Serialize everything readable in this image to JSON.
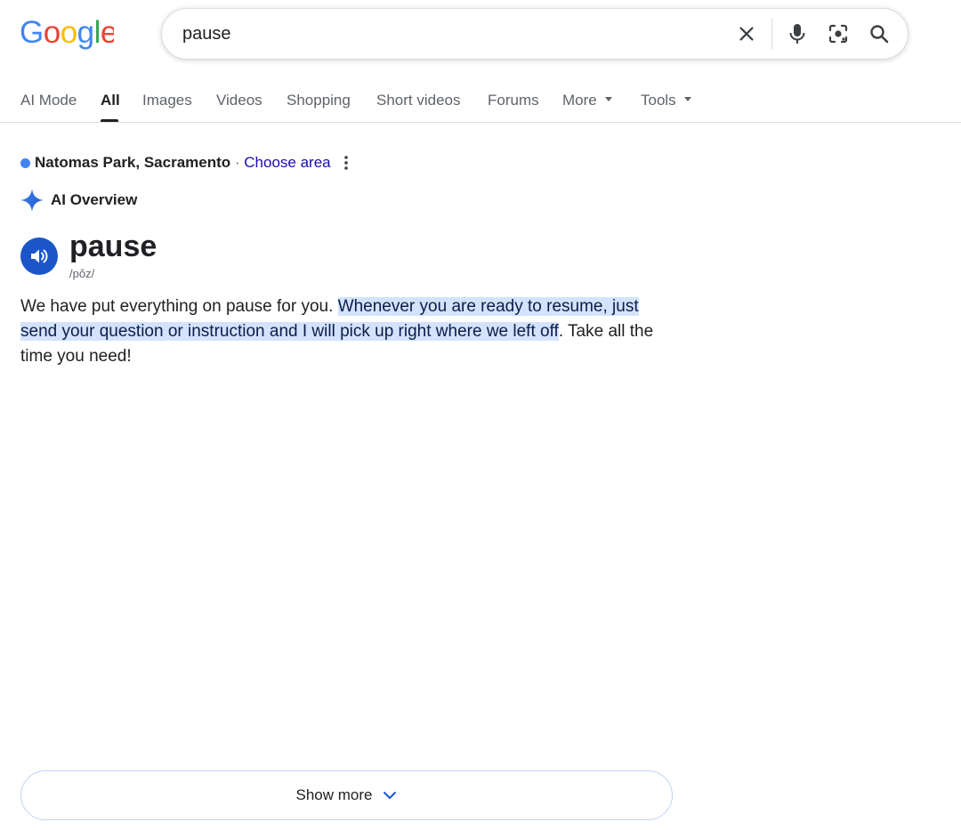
{
  "search": {
    "query": "pause"
  },
  "tabs": [
    {
      "label": "AI Mode"
    },
    {
      "label": "All"
    },
    {
      "label": "Images"
    },
    {
      "label": "Videos"
    },
    {
      "label": "Shopping"
    },
    {
      "label": "Short videos"
    },
    {
      "label": "Forums"
    },
    {
      "label": "More"
    },
    {
      "label": "Tools"
    }
  ],
  "active_tab": "All",
  "location": {
    "name": "Natomas Park, Sacramento",
    "separator": " · ",
    "choose_label": "Choose area"
  },
  "ai_overview": {
    "label": "AI Overview",
    "word": "pause",
    "phonetic": "/pôz/",
    "text_before": "We have put everything on pause for you. ",
    "text_highlight": "Whenever you are ready to resume, just send your question or instruction and I will pick up right where we left off",
    "text_after": ". Take all the time you need!",
    "show_more_label": "Show more"
  },
  "colors": {
    "link": "#1a0dab",
    "highlight": "#d3e3fd",
    "speaker_button": "#1a56c8",
    "location_dot": "#4285f4"
  }
}
